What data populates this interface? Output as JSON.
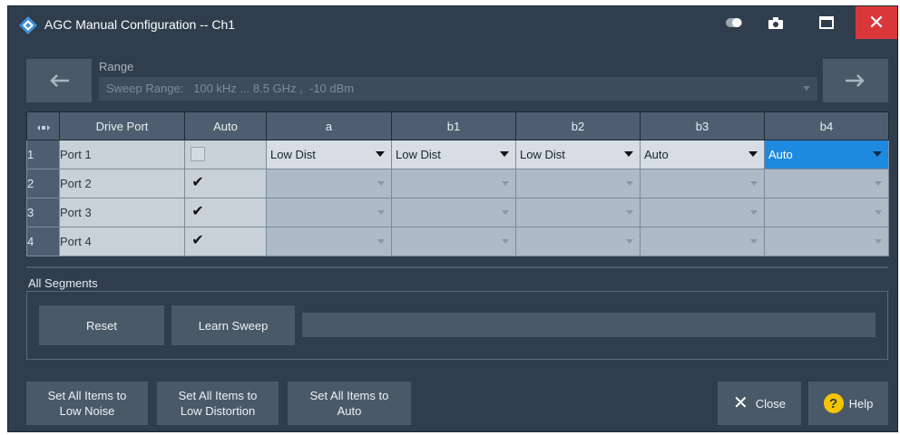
{
  "window": {
    "title": "AGC Manual Configuration -- Ch1",
    "close_symbol": "✕"
  },
  "range": {
    "label": "Range",
    "value": "Sweep Range:   100 kHz ... 8.5 GHz ,  -10 dBm"
  },
  "table": {
    "headers": [
      "Drive Port",
      "Auto",
      "a",
      "b1",
      "b2",
      "b3",
      "b4"
    ],
    "rows": [
      {
        "num": "1",
        "port": "Port 1",
        "auto": false,
        "a": "Low Dist",
        "b1": "Low Dist",
        "b2": "Low Dist",
        "b3": "Auto",
        "b4": "Auto"
      },
      {
        "num": "2",
        "port": "Port 2",
        "auto": true,
        "a": "",
        "b1": "",
        "b2": "",
        "b3": "",
        "b4": ""
      },
      {
        "num": "3",
        "port": "Port 3",
        "auto": true,
        "a": "",
        "b1": "",
        "b2": "",
        "b3": "",
        "b4": ""
      },
      {
        "num": "4",
        "port": "Port 4",
        "auto": true,
        "a": "",
        "b1": "",
        "b2": "",
        "b3": "",
        "b4": ""
      }
    ]
  },
  "segments": {
    "label": "All Segments",
    "reset_label": "Reset",
    "learn_label": "Learn Sweep",
    "progress": 0
  },
  "footer": {
    "low_noise_1": "Set All Items to",
    "low_noise_2": "Low Noise",
    "low_dist_1": "Set All Items to",
    "low_dist_2": "Low Distortion",
    "auto_1": "Set All Items to",
    "auto_2": "Auto",
    "close_label": "Close",
    "help_label": "Help",
    "help_symbol": "?"
  },
  "colors": {
    "accent": "#1e8adf",
    "close": "#d9373a",
    "help": "#f5c400"
  }
}
